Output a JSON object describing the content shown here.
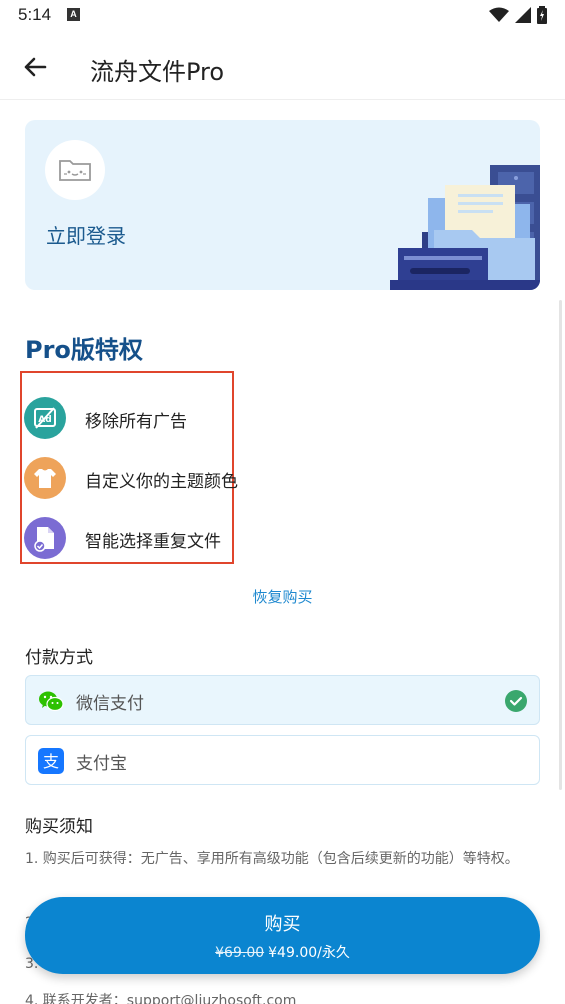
{
  "status_bar": {
    "time": "5:14",
    "a_badge": "A"
  },
  "app_bar": {
    "title": "流舟文件Pro"
  },
  "login_card": {
    "label": "立即登录"
  },
  "pro_section": {
    "title": "Pro版特权",
    "perks": [
      {
        "label": "移除所有广告",
        "icon": "ad-block-icon",
        "color": "#2aa39d"
      },
      {
        "label": "自定义你的主题颜色",
        "icon": "shirt-icon",
        "color": "#eea35a"
      },
      {
        "label": "智能选择重复文件",
        "icon": "duplicate-file-icon",
        "color": "#7b6cd3"
      }
    ]
  },
  "restore_purchase": "恢复购买",
  "payment": {
    "title": "付款方式",
    "options": [
      {
        "label": "微信支付",
        "icon": "wechat-icon",
        "selected": true
      },
      {
        "label": "支付宝",
        "icon": "alipay-icon",
        "selected": false
      }
    ]
  },
  "notice": {
    "title": "购买须知",
    "items": [
      "1. 购买后可获得：无广告、享用所有高级功能（包含后续更新的功能）等特权。",
      "2.",
      "3.",
      "4. 联系开发者：support@liuzhosoft.com"
    ]
  },
  "buy_button": {
    "label": "购买",
    "old_price": "¥69.00",
    "price": "¥49.00/永久"
  },
  "colors": {
    "accent": "#0b85d0",
    "title_blue": "#15508a",
    "highlight_box": "#e0452c"
  }
}
